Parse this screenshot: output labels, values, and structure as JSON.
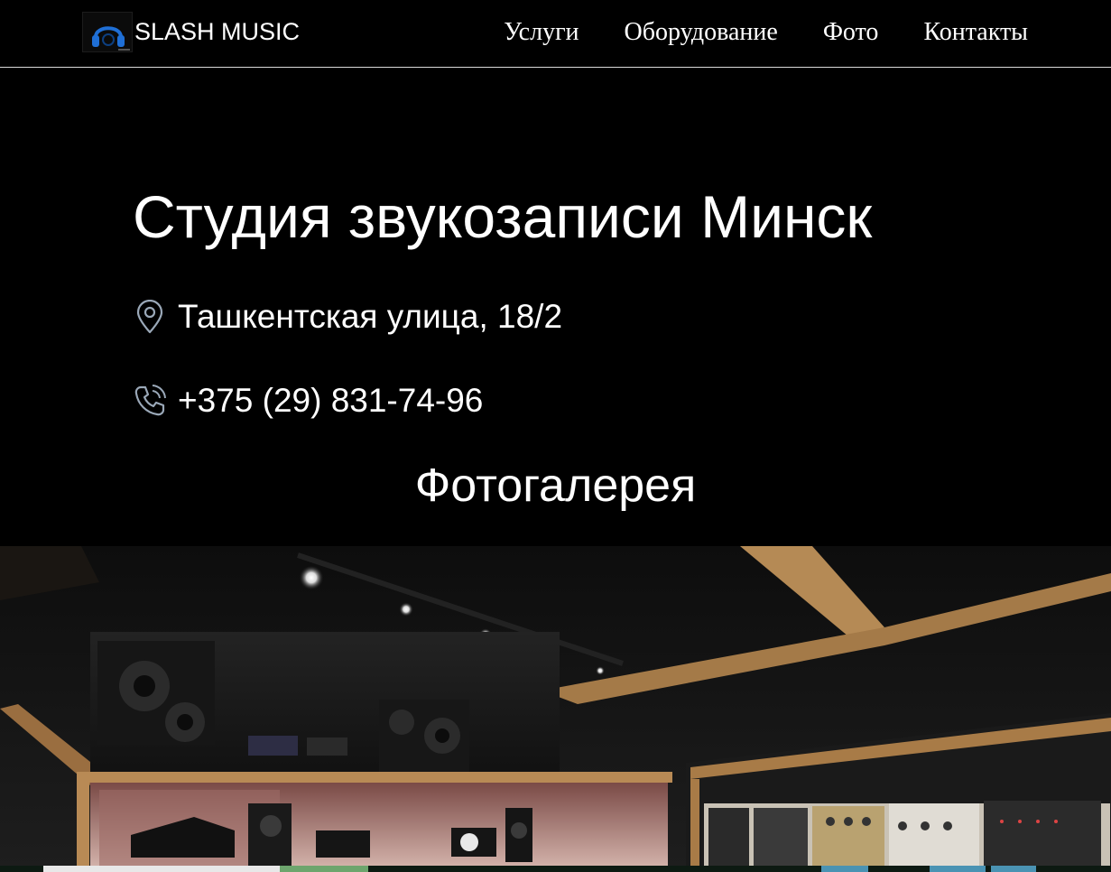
{
  "header": {
    "brand": "SLASH MUSIC",
    "logo_icon": "headphones-logo-icon",
    "nav": [
      {
        "label": "Услуги"
      },
      {
        "label": "Оборудование"
      },
      {
        "label": "Фото"
      },
      {
        "label": "Контакты"
      }
    ]
  },
  "hero": {
    "title": "Студия звукозаписи Минск",
    "address": "Ташкентская улица, 18/2",
    "address_icon": "map-pin-icon",
    "phone": "+375 (29) 831-74-96",
    "phone_icon": "phone-icon",
    "gallery_title": "Фотогалерея"
  },
  "gallery": {
    "photo_subject": "recording-studio-control-room-photo"
  },
  "colors": {
    "background": "#000000",
    "text": "#ffffff",
    "accent": "#1f6fd6",
    "icon_stroke": "#9aa8b8",
    "divider": "#d9d9d9"
  }
}
